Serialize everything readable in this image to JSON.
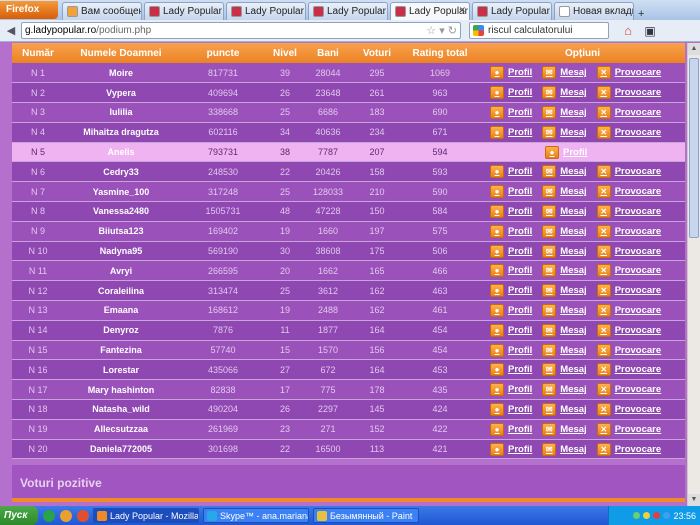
{
  "browser": {
    "menu_label": "Firefox",
    "tabs": [
      {
        "label": "Вам сообщение!",
        "icon": "mail-icon",
        "color": "#f2a23a",
        "active": false
      },
      {
        "label": "Lady Popular",
        "icon": "lady-popular-icon",
        "color": "#c8304a",
        "active": false
      },
      {
        "label": "Lady Popular",
        "icon": "lady-popular-icon",
        "color": "#c8304a",
        "active": false
      },
      {
        "label": "Lady Popular",
        "icon": "lady-popular-icon",
        "color": "#c8304a",
        "active": false
      },
      {
        "label": "Lady Popular",
        "icon": "lady-popular-icon",
        "color": "#c8304a",
        "active": true
      },
      {
        "label": "Lady Popular",
        "icon": "lady-popular-icon",
        "color": "#c8304a",
        "active": false
      },
      {
        "label": "Новая вкладка",
        "icon": "blank-page-icon",
        "color": "#ffffff",
        "active": false
      }
    ],
    "url_host": "g.ladypopular.ro",
    "url_path": "/podium.php",
    "search_value": "riscul calculatorului"
  },
  "table": {
    "headers": [
      "Număr",
      "Numele Doamnei",
      "puncte",
      "Nivel",
      "Bani",
      "Voturi",
      "Rating total",
      "Opțiuni"
    ],
    "profile_label": "Profil",
    "message_label": "Mesaj",
    "challenge_label": "Provocare",
    "rows": [
      {
        "rank": "N 1",
        "name": "Moire",
        "points": "817731",
        "level": "39",
        "money": "28044",
        "votes": "295",
        "rating": "1069"
      },
      {
        "rank": "N 2",
        "name": "Vypera",
        "points": "409694",
        "level": "26",
        "money": "23648",
        "votes": "261",
        "rating": "963"
      },
      {
        "rank": "N 3",
        "name": "Iulilia",
        "points": "338668",
        "level": "25",
        "money": "6686",
        "votes": "183",
        "rating": "690"
      },
      {
        "rank": "N 4",
        "name": "Mihaitza dragutza",
        "points": "602116",
        "level": "34",
        "money": "40636",
        "votes": "234",
        "rating": "671"
      },
      {
        "rank": "N 5",
        "name": "Anelis",
        "points": "793731",
        "level": "38",
        "money": "7787",
        "votes": "207",
        "rating": "594",
        "self": true
      },
      {
        "rank": "N 6",
        "name": "Cedry33",
        "points": "248530",
        "level": "22",
        "money": "20426",
        "votes": "158",
        "rating": "593"
      },
      {
        "rank": "N 7",
        "name": "Yasmine_100",
        "points": "317248",
        "level": "25",
        "money": "128033",
        "votes": "210",
        "rating": "590"
      },
      {
        "rank": "N 8",
        "name": "Vanessa2480",
        "points": "1505731",
        "level": "48",
        "money": "47228",
        "votes": "150",
        "rating": "584"
      },
      {
        "rank": "N 9",
        "name": "Biiutsa123",
        "points": "169402",
        "level": "19",
        "money": "1660",
        "votes": "197",
        "rating": "575"
      },
      {
        "rank": "N 10",
        "name": "Nadyna95",
        "points": "569190",
        "level": "30",
        "money": "38608",
        "votes": "175",
        "rating": "506"
      },
      {
        "rank": "N 11",
        "name": "Avryi",
        "points": "266595",
        "level": "20",
        "money": "1662",
        "votes": "165",
        "rating": "466"
      },
      {
        "rank": "N 12",
        "name": "Coraleilina",
        "points": "313474",
        "level": "25",
        "money": "3612",
        "votes": "162",
        "rating": "463"
      },
      {
        "rank": "N 13",
        "name": "Emaana",
        "points": "168612",
        "level": "19",
        "money": "2488",
        "votes": "162",
        "rating": "461"
      },
      {
        "rank": "N 14",
        "name": "Denyroz",
        "points": "7876",
        "level": "11",
        "money": "1877",
        "votes": "164",
        "rating": "454"
      },
      {
        "rank": "N 15",
        "name": "Fantezina",
        "points": "57740",
        "level": "15",
        "money": "1570",
        "votes": "156",
        "rating": "454"
      },
      {
        "rank": "N 16",
        "name": "Lorestar",
        "points": "435066",
        "level": "27",
        "money": "672",
        "votes": "164",
        "rating": "453"
      },
      {
        "rank": "N 17",
        "name": "Mary hashinton",
        "points": "82838",
        "level": "17",
        "money": "775",
        "votes": "178",
        "rating": "435"
      },
      {
        "rank": "N 18",
        "name": "Natasha_wild",
        "points": "490204",
        "level": "26",
        "money": "2297",
        "votes": "145",
        "rating": "424"
      },
      {
        "rank": "N 19",
        "name": "Allecsutzzaa",
        "points": "261969",
        "level": "23",
        "money": "271",
        "votes": "152",
        "rating": "422"
      },
      {
        "rank": "N 20",
        "name": "Daniela772005",
        "points": "301698",
        "level": "22",
        "money": "16500",
        "votes": "113",
        "rating": "421"
      }
    ]
  },
  "votes_section_title": "Voturi pozitive",
  "taskbar": {
    "start_label": "Пуск",
    "tasks": [
      {
        "label": "Lady Popular - Mozilla...",
        "icon": "firefox-icon",
        "color": "#f08a28",
        "active": true
      },
      {
        "label": "Skype™ - ana.mariana12",
        "icon": "skype-icon",
        "color": "#27a8e8",
        "active": false
      },
      {
        "label": "Безымянный - Paint",
        "icon": "paint-icon",
        "color": "#e8c040",
        "active": false
      }
    ],
    "clock": "23:56"
  }
}
